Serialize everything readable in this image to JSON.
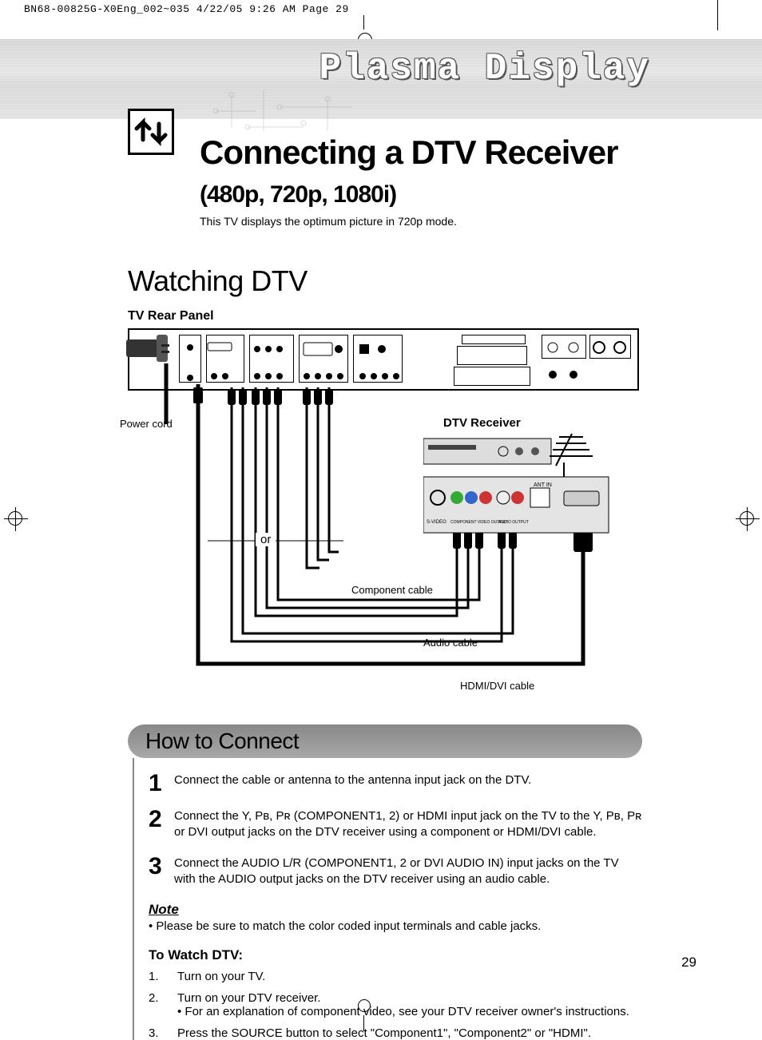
{
  "meta": {
    "header_line": "BN68-00825G-X0Eng_002~035  4/22/05  9:26 AM  Page 29"
  },
  "brand_title": "Plasma Display",
  "title": {
    "main": "Connecting a DTV Receiver",
    "modes": "(480p, 720p, 1080i)",
    "sub": "This TV displays the optimum picture in 720p mode."
  },
  "section": "Watching DTV",
  "panel_label": "TV Rear Panel",
  "diagram": {
    "power_cord": "Power cord",
    "or": "or",
    "receiver": "DTV Receiver",
    "component_cable": "Component cable",
    "audio_cable": "Audio cable",
    "hdmi_cable": "HDMI/DVI cable"
  },
  "how_to": {
    "title": "How to Connect",
    "steps": [
      "Connect the cable or antenna to the antenna input jack on the DTV.",
      "Connect the Y, Pʙ, Pʀ (COMPONENT1, 2) or HDMI input jack on the TV to the Y, Pʙ, Pʀ or DVI output jacks on the DTV receiver using a component or HDMI/DVI cable.",
      "Connect the AUDIO L/R (COMPONENT1, 2 or DVI AUDIO IN) input jacks on the TV with the AUDIO output jacks on the DTV receiver using an audio cable."
    ]
  },
  "note": {
    "head": "Note",
    "body": "•  Please be sure to match the color coded input terminals and cable jacks."
  },
  "watch": {
    "head": "To Watch DTV:",
    "items": [
      {
        "n": "1.",
        "text": "Turn on your TV."
      },
      {
        "n": "2.",
        "text": "Turn on your DTV receiver.\n• For an explanation of component video, see your DTV receiver owner's instructions."
      },
      {
        "n": "3.",
        "text": "Press the SOURCE button to select \"Component1\", \"Component2\" or \"HDMI\"."
      }
    ]
  },
  "page_number": "29"
}
